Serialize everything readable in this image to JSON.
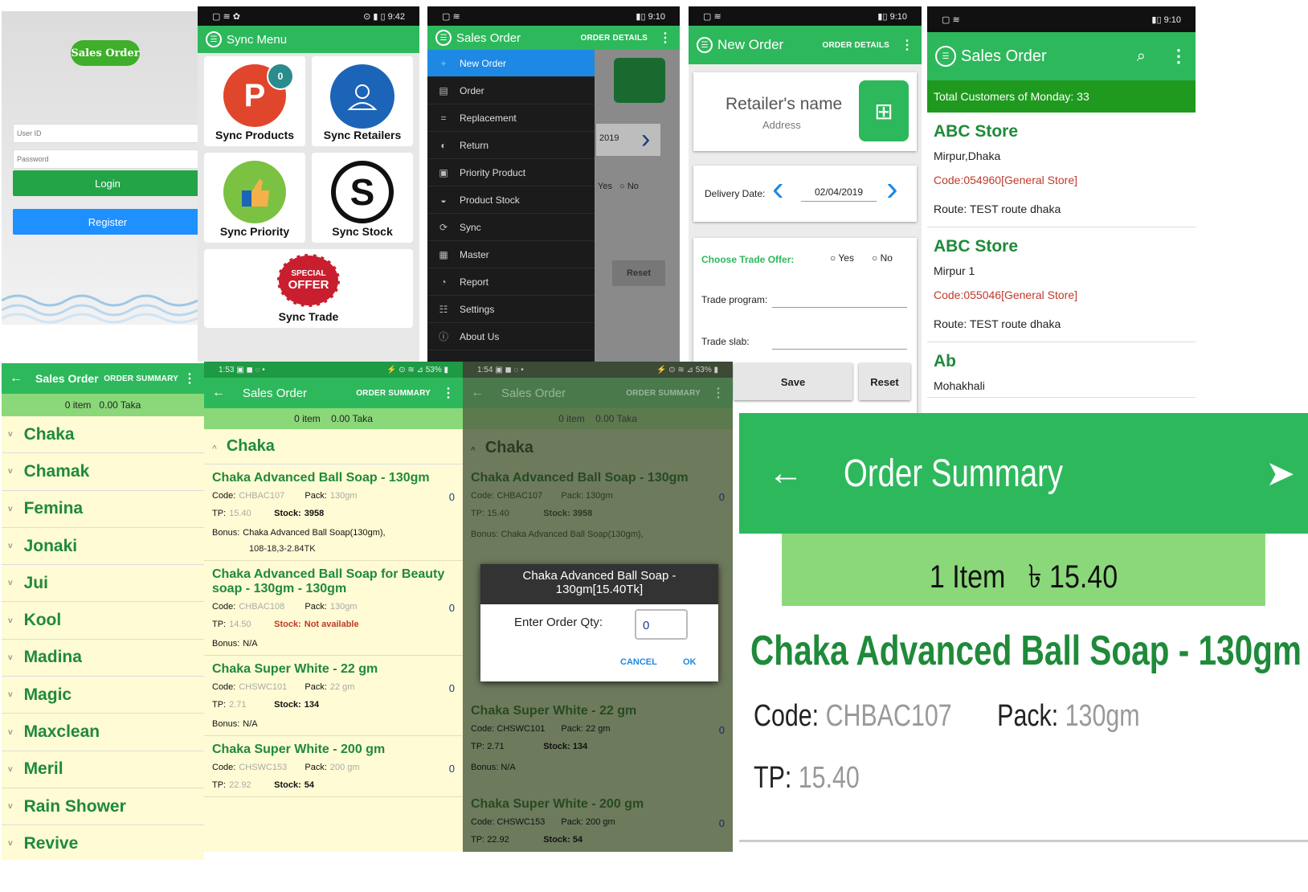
{
  "login": {
    "logo": "Sales Order",
    "userid_ph": "User ID",
    "password_ph": "Password",
    "login": "Login",
    "register": "Register"
  },
  "sync": {
    "status_left": "▢ ≋ ✿",
    "status_right": "⊙ ▮ ▯ 9:42",
    "title": "Sync Menu",
    "badge": "0",
    "cards": [
      "Sync Products",
      "Sync Retailers",
      "Sync Priority",
      "Sync Stock",
      "Sync Trade"
    ],
    "offer_top": "SPECIAL",
    "offer_main": "OFFER"
  },
  "drawer": {
    "status_left": "▢ ≋",
    "status_right": "▮▯ 9:10",
    "title": "Sales Order",
    "action": "ORDER DETAILS",
    "items": [
      "New Order",
      "Order",
      "Replacement",
      "Return",
      "Priority Product",
      "Product Stock",
      "Sync",
      "Master",
      "Report",
      "Settings",
      "About Us"
    ],
    "bg_date": "2019",
    "bg_yes": "Yes",
    "bg_no": "No",
    "bg_reset": "Reset"
  },
  "neworder": {
    "status_left": "▢ ≋",
    "status_right": "▮▯ 9:10",
    "title": "New Order",
    "action": "ORDER DETAILS",
    "retailer": "Retailer's name",
    "address": "Address",
    "delivery_label": "Delivery Date:",
    "delivery_date": "02/04/2019",
    "trade_offer": "Choose Trade Offer:",
    "yes": "Yes",
    "no": "No",
    "trade_program": "Trade program:",
    "trade_slab": "Trade slab:",
    "save": "Save",
    "reset": "Reset"
  },
  "customers": {
    "status_left": "▢ ≋",
    "status_right": "▮▯ 9:10",
    "title": "Sales Order",
    "total": "Total Customers of Monday: 33",
    "list": [
      {
        "name": "ABC Store",
        "addr": "Mirpur,Dhaka",
        "code": "Code:054960[General Store]",
        "route": "Route: TEST route dhaka"
      },
      {
        "name": "ABC Store",
        "addr": "Mirpur 1",
        "code": "Code:055046[General Store]",
        "route": "Route: TEST route dhaka"
      },
      {
        "name": "Ab",
        "addr": "Mohakhali",
        "code": "",
        "route": ""
      }
    ]
  },
  "summary1": {
    "title": "Sales Order",
    "action": "ORDER SUMMARY",
    "total": "0 item   0.00 Taka",
    "brands": [
      "Chaka",
      "Chamak",
      "Femina",
      "Jonaki",
      "Jui",
      "Kool",
      "Madina",
      "Magic",
      "Maxclean",
      "Meril",
      "Rain Shower",
      "Revive"
    ]
  },
  "summary2": {
    "status_left": "1:53 ▣ ◼ ◌ •",
    "status_right": "⚡ ⊙ ≋ ⊿ 53% ▮",
    "title": "Sales Order",
    "action": "ORDER SUMMARY",
    "total": "0 item    0.00 Taka",
    "brand": "Chaka",
    "products": [
      {
        "name": "Chaka Advanced Ball Soap - 130gm",
        "code": "CHBAC107",
        "pack": "130gm",
        "tp": "15.40",
        "stock": "3958",
        "qty": "0",
        "bonus": "Chaka Advanced Ball Soap(130gm),",
        "bonus2": "108-18,3-2.84TK"
      },
      {
        "name": "Chaka Advanced Ball Soap for Beauty soap - 130gm - 130gm",
        "code": "CHBAC108",
        "pack": "130gm",
        "tp": "14.50",
        "stock": "Not available",
        "qty": "0",
        "bonus": "N/A",
        "bonus2": ""
      },
      {
        "name": "Chaka Super White - 22 gm",
        "code": "CHSWC101",
        "pack": "22 gm",
        "tp": "2.71",
        "stock": "134",
        "qty": "0",
        "bonus": "N/A",
        "bonus2": ""
      },
      {
        "name": "Chaka Super White - 200 gm",
        "code": "CHSWC153",
        "pack": "200 gm",
        "tp": "22.92",
        "stock": "54",
        "qty": "0",
        "bonus": "",
        "bonus2": ""
      }
    ],
    "labels": {
      "code": "Code:",
      "pack": "Pack:",
      "tp": "TP:",
      "stock": "Stock:",
      "bonus": "Bonus:"
    }
  },
  "dialog": {
    "status_left": "1:54 ▣ ◼ ◌ •",
    "status_right": "⚡ ⊙ ≋ ⊿ 53% ▮",
    "title": "Sales Order",
    "action": "ORDER SUMMARY",
    "total": "0 item    0.00 Taka",
    "brand": "Chaka",
    "dlg_title": "Chaka Advanced Ball Soap - 130gm[15.40Tk]",
    "qty_label": "Enter Order Qty:",
    "qty_value": "0",
    "cancel": "CANCEL",
    "ok": "OK",
    "p1": {
      "name": "Chaka Advanced Ball Soap - 130gm",
      "code": "CHBAC107",
      "pack": "130gm",
      "tp": "15.40",
      "stock": "3958",
      "bonus": "Chaka Advanced Ball Soap(130gm),"
    },
    "p3": {
      "name": "Chaka Super White - 22 gm",
      "code": "CHSWC101",
      "pack": "22 gm",
      "tp": "2.71",
      "stock": "134",
      "bonus": "N/A"
    },
    "p4": {
      "name": "Chaka Super White - 200 gm",
      "code": "CHSWC153",
      "pack": "200 gm",
      "tp": "22.92",
      "stock": "54"
    }
  },
  "zoom": {
    "title": "Order Summary",
    "total": "1 Item   ৳ 15.40",
    "product": "Chaka Advanced Ball Soap - 130gm",
    "code_label": "Code:",
    "code": "CHBAC107",
    "pack_label": "Pack:",
    "pack": "130gm",
    "tp_label": "TP:",
    "tp": "15.40"
  },
  "colors": {
    "green": "#2eb85c",
    "dark_green": "#1f8a3a",
    "blue": "#1e88e5",
    "drawer": "#1b1b1b"
  }
}
